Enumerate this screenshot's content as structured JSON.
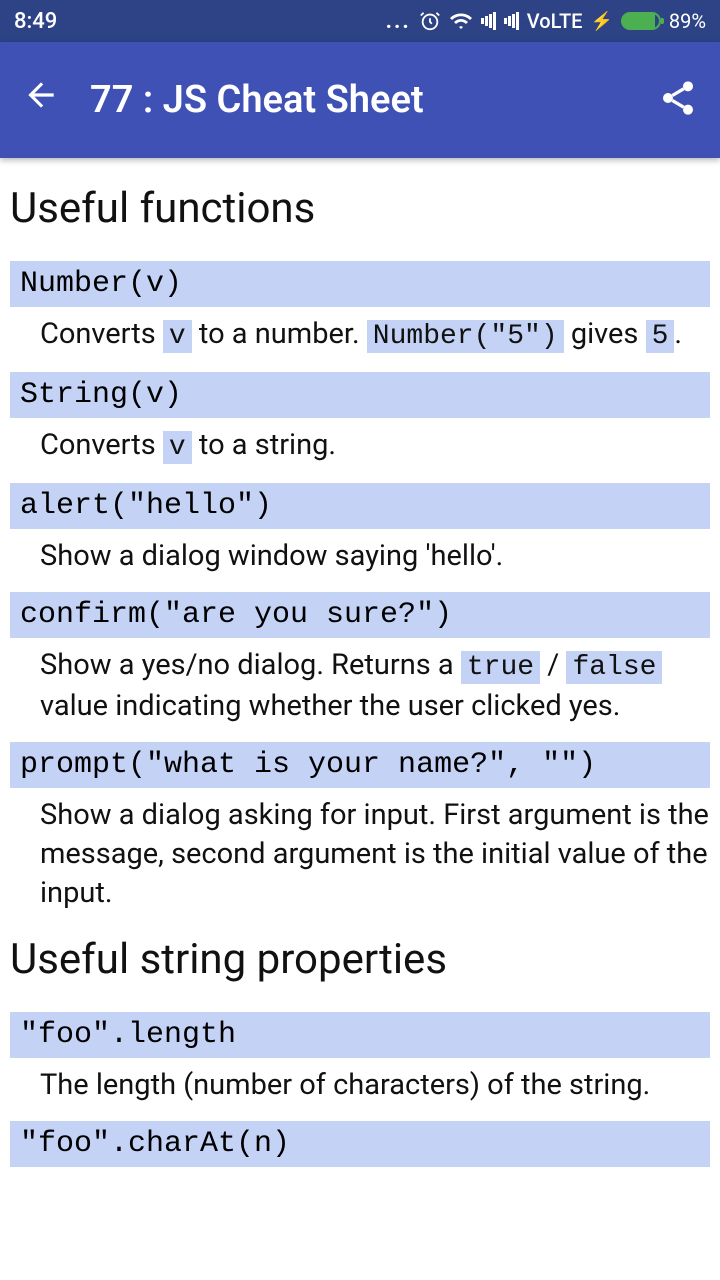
{
  "status": {
    "time": "8:49",
    "volte": "VoLTE",
    "battery": "89%"
  },
  "header": {
    "title": "77 : JS Cheat Sheet"
  },
  "sections": [
    {
      "heading": "Useful functions",
      "items": [
        {
          "head": "Number(v)",
          "desc_parts": [
            "Converts ",
            "v",
            " to a number. ",
            "Number(\"5\")",
            " gives ",
            "5",
            "."
          ],
          "code_flags": [
            false,
            true,
            false,
            true,
            false,
            true,
            false
          ]
        },
        {
          "head": "String(v)",
          "desc_parts": [
            "Converts ",
            "v",
            " to a string."
          ],
          "code_flags": [
            false,
            true,
            false
          ]
        },
        {
          "head": "alert(\"hello\")",
          "desc_parts": [
            "Show a dialog window saying 'hello'."
          ],
          "code_flags": [
            false
          ]
        },
        {
          "head": "confirm(\"are you sure?\")",
          "desc_parts": [
            "Show a yes/no dialog. Returns a ",
            "true",
            " / ",
            "false",
            " value indicating whether the user clicked yes."
          ],
          "code_flags": [
            false,
            true,
            false,
            true,
            false
          ]
        },
        {
          "head": "prompt(\"what is your name?\", \"\")",
          "desc_parts": [
            "Show a dialog asking for input. First argument is the message, second argument is the initial value of the input."
          ],
          "code_flags": [
            false
          ]
        }
      ]
    },
    {
      "heading": "Useful string properties",
      "items": [
        {
          "head": "\"foo\".length",
          "desc_parts": [
            "The length (number of characters) of the string."
          ],
          "code_flags": [
            false
          ]
        },
        {
          "head": "\"foo\".charAt(n)",
          "desc_parts": [
            ""
          ],
          "code_flags": [
            false
          ]
        }
      ]
    }
  ]
}
